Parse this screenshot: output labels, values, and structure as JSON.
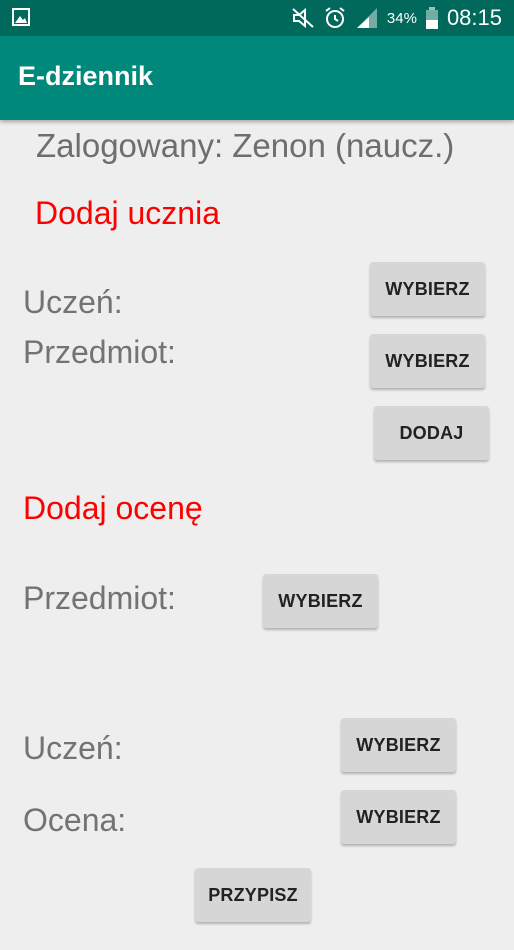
{
  "status_bar": {
    "battery_percent": "34%",
    "time": "08:15",
    "icons": [
      "gallery-icon",
      "mute-icon",
      "alarm-icon",
      "signal-icon",
      "battery-icon"
    ]
  },
  "app_bar": {
    "title": "E-dziennik"
  },
  "main": {
    "logged_in_text": "Zalogowany: Zenon (naucz.)",
    "add_student": {
      "title": "Dodaj ucznia",
      "student_label": "Uczeń:",
      "student_button": "WYBIERZ",
      "subject_label": "Przedmiot:",
      "subject_button": "WYBIERZ",
      "add_button": "DODAJ"
    },
    "add_grade": {
      "title": "Dodaj ocenę",
      "subject_label": "Przedmiot:",
      "subject_button": "WYBIERZ",
      "student_label": "Uczeń:",
      "student_button": "WYBIERZ",
      "grade_label": "Ocena:",
      "grade_button": "WYBIERZ",
      "assign_button": "PRZYPISZ"
    }
  },
  "colors": {
    "status_bar": "#00695c",
    "app_bar": "#00897b",
    "section_title": "#ff0000",
    "background": "#eeeeee",
    "button": "#d6d6d6"
  }
}
